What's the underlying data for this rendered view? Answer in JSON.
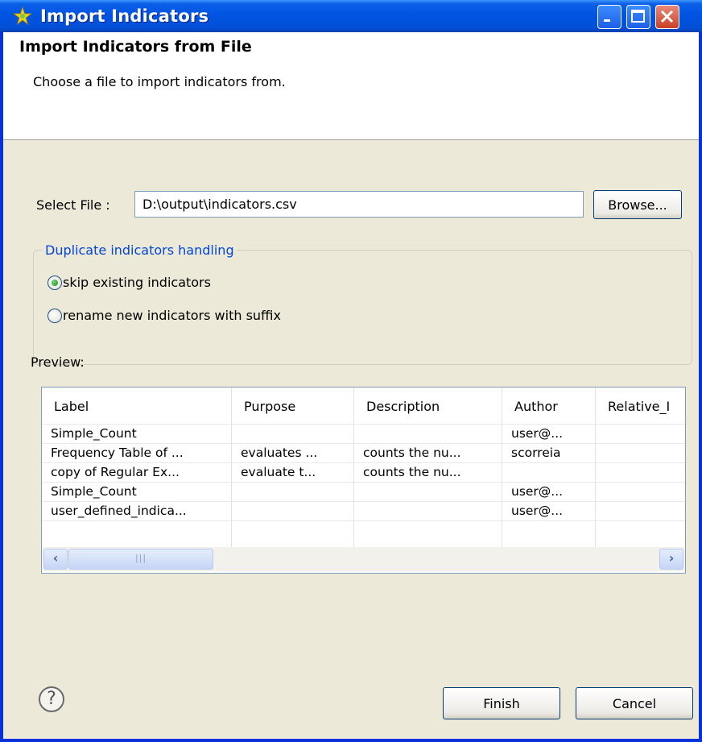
{
  "window": {
    "title": "Import Indicators",
    "icon": "star-sparkle-icon"
  },
  "banner": {
    "title": "Import Indicators from File",
    "description": "Choose a file to import indicators from."
  },
  "file": {
    "label": "Select File :",
    "value": "D:\\output\\indicators.csv",
    "browse_label": "Browse..."
  },
  "duplicates": {
    "group_title": "Duplicate indicators handling",
    "options": [
      {
        "label": "skip existing indicators",
        "selected": true
      },
      {
        "label": "rename new indicators with suffix",
        "selected": false
      }
    ]
  },
  "preview": {
    "label": "Preview:",
    "columns": [
      "Label",
      "Purpose",
      "Description",
      "Author",
      "Relative_I"
    ],
    "rows": [
      [
        "Simple_Count",
        "",
        "",
        "user@...",
        ""
      ],
      [
        "Frequency Table of ...",
        "evaluates ...",
        "counts the nu...",
        "scorreia",
        ""
      ],
      [
        "copy of Regular Ex...",
        "evaluate t...",
        "counts the nu...",
        "",
        ""
      ],
      [
        "Simple_Count",
        "",
        "",
        "user@...",
        ""
      ],
      [
        "user_defined_indica...",
        "",
        "",
        "user@...",
        ""
      ]
    ]
  },
  "footer": {
    "finish_label": "Finish",
    "cancel_label": "Cancel"
  },
  "colors": {
    "titlebar": "#0053e1",
    "dialog_bg": "#ece9d8",
    "group_title": "#0046d5"
  }
}
